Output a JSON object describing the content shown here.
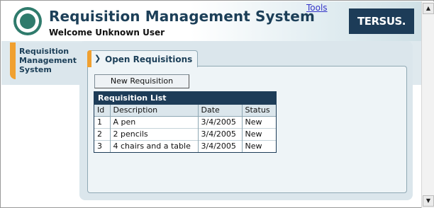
{
  "header": {
    "title": "Requisition Management System",
    "welcome": "Welcome Unknown User",
    "tools_link": "Tools",
    "brand": "TERSUS.",
    "logo_icon": "circle-logo-icon"
  },
  "sidebar": {
    "items": [
      {
        "label": "Requisition Management System"
      }
    ]
  },
  "tabs": [
    {
      "label": "Open Requisitions",
      "icon": "chevron-right-icon",
      "chevron": "❯"
    }
  ],
  "toolbar": {
    "new_requisition_label": "New Requisition"
  },
  "table": {
    "caption": "Requisition List",
    "columns": [
      "Id",
      "Description",
      "Date",
      "Status"
    ],
    "rows": [
      [
        "1",
        "A pen",
        "3/4/2005",
        "New"
      ],
      [
        "2",
        "2 pencils",
        "3/4/2005",
        "New"
      ],
      [
        "3",
        "4 chairs and a table",
        "3/4/2005",
        "New"
      ]
    ]
  },
  "scrollbar": {
    "up_glyph": "▲",
    "down_glyph": "▼"
  },
  "colors": {
    "navy": "#1d3c58",
    "accent": "#f0a030",
    "panel": "#dbe6ec",
    "link": "#3434c8"
  }
}
